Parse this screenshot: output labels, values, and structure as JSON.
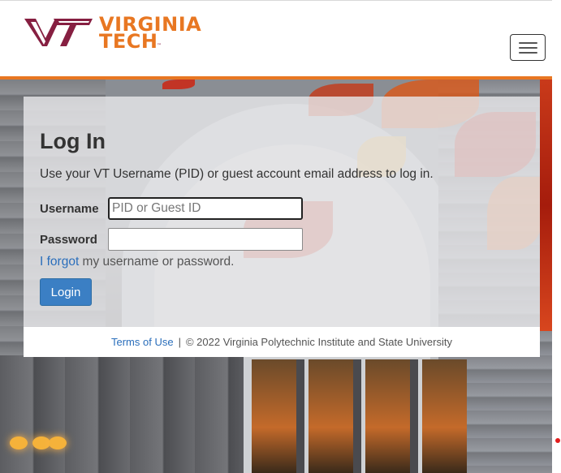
{
  "header": {
    "logo_line1": "VIRGINIA",
    "logo_line2": "TECH",
    "logo_tm": "™",
    "menu_icon": "hamburger-menu-icon"
  },
  "login": {
    "title": "Log In",
    "description": "Use your VT Username (PID) or guest account email address to log in.",
    "username_label": "Username",
    "username_placeholder": "PID or Guest ID",
    "username_value": "",
    "password_label": "Password",
    "password_value": "",
    "forgot_link": "I forgot",
    "forgot_rest": " my username or password.",
    "login_button": "Login"
  },
  "footer": {
    "terms_link": "Terms of Use",
    "separator": "|",
    "copyright": "© 2022 Virginia Polytechnic Institute and State University"
  },
  "colors": {
    "brand_orange": "#e87722",
    "brand_maroon": "#861f41",
    "link_blue": "#2a6ebb",
    "button_blue": "#3b7fc4"
  }
}
